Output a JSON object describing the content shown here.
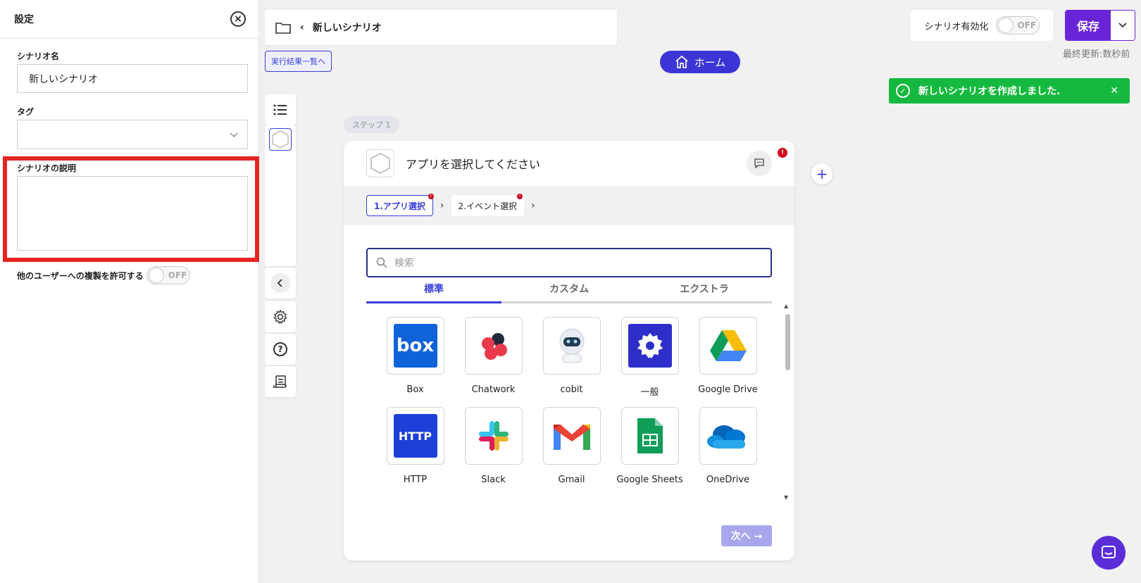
{
  "settings": {
    "title": "設定",
    "scenario_name_label": "シナリオ名",
    "scenario_name_value": "新しいシナリオ",
    "tag_label": "タグ",
    "description_label": "シナリオの説明",
    "allow_copy_label": "他のユーザーへの複製を許可する",
    "allow_copy_toggle": "OFF"
  },
  "topbar": {
    "title": "新しいシナリオ",
    "results_button": "実行結果一覧へ",
    "home_button": "ホーム",
    "enable_label": "シナリオ有効化",
    "enable_toggle": "OFF",
    "save_button": "保存",
    "last_updated": "最終更新:数秒前"
  },
  "toast": {
    "message": "新しいシナリオを作成しました."
  },
  "step": {
    "pill": "ステップ 1",
    "card_title": "アプリを選択してください",
    "error_mark": "!",
    "tabs": [
      "1.アプリ選択",
      "2.イベント選択"
    ],
    "search_placeholder": "検索",
    "categories": [
      "標準",
      "カスタム",
      "エクストラ"
    ],
    "apps": [
      "Box",
      "Chatwork",
      "cobit",
      "一般",
      "Google Drive",
      "HTTP",
      "Slack",
      "Gmail",
      "Google Sheets",
      "OneDrive"
    ],
    "box_logo_text": "box",
    "http_logo_text": "HTTP",
    "next_button": "次へ →"
  },
  "colors": {
    "accent": "#3b35d6",
    "save": "#6a24d8",
    "success": "#15b93f",
    "error": "#d0021b",
    "highlight": "#e52424"
  }
}
